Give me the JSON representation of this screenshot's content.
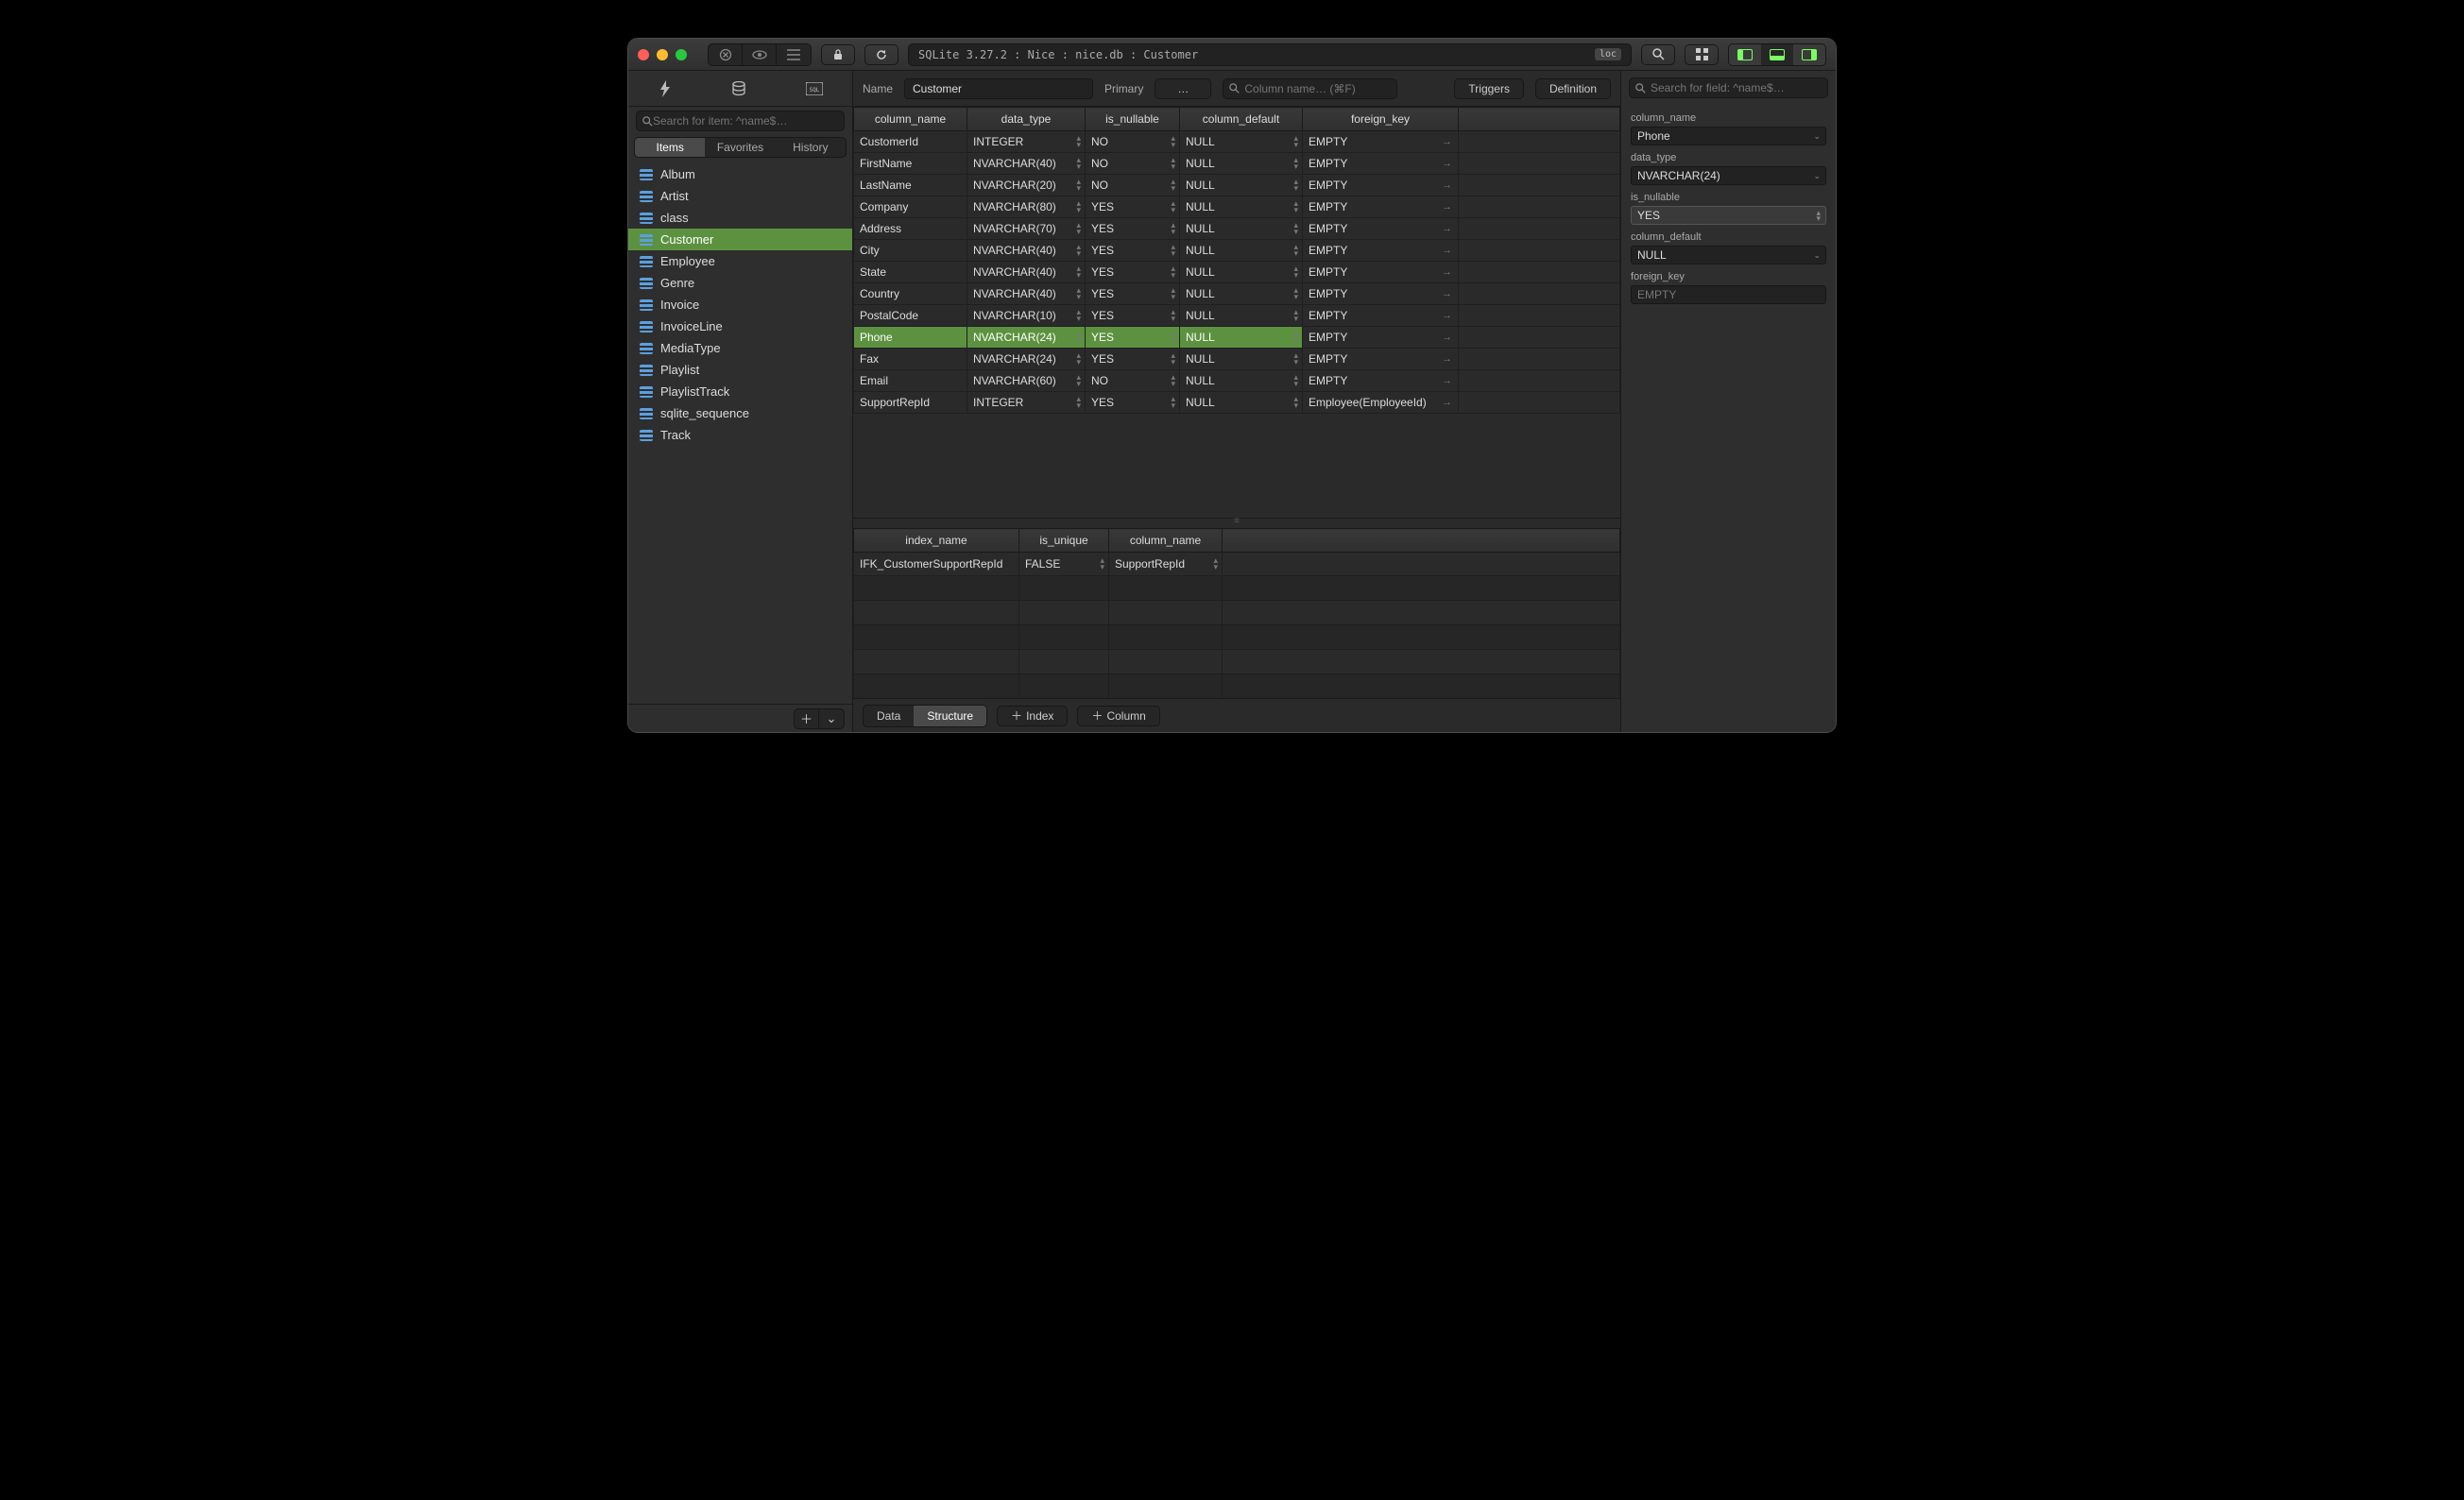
{
  "titlebar": {
    "path": "SQLite 3.27.2 : Nice : nice.db : Customer",
    "loc_chip": "loc"
  },
  "sidebar": {
    "search_placeholder": "Search for item: ^name$…",
    "tabs": {
      "items": "Items",
      "favorites": "Favorites",
      "history": "History"
    },
    "items": [
      {
        "label": "Album"
      },
      {
        "label": "Artist"
      },
      {
        "label": "class"
      },
      {
        "label": "Customer",
        "selected": true
      },
      {
        "label": "Employee"
      },
      {
        "label": "Genre"
      },
      {
        "label": "Invoice"
      },
      {
        "label": "InvoiceLine"
      },
      {
        "label": "MediaType"
      },
      {
        "label": "Playlist"
      },
      {
        "label": "PlaylistTrack"
      },
      {
        "label": "sqlite_sequence"
      },
      {
        "label": "Track"
      }
    ]
  },
  "header": {
    "name_label": "Name",
    "name_value": "Customer",
    "primary_label": "Primary",
    "primary_value": "…",
    "column_search_placeholder": "Column name… (⌘F)",
    "triggers_btn": "Triggers",
    "definition_btn": "Definition"
  },
  "columns_grid": {
    "headers": [
      "column_name",
      "data_type",
      "is_nullable",
      "column_default",
      "foreign_key"
    ],
    "rows": [
      {
        "name": "CustomerId",
        "type": "INTEGER",
        "nullable": "NO",
        "default": "NULL",
        "fk": "EMPTY"
      },
      {
        "name": "FirstName",
        "type": "NVARCHAR(40)",
        "nullable": "NO",
        "default": "NULL",
        "fk": "EMPTY"
      },
      {
        "name": "LastName",
        "type": "NVARCHAR(20)",
        "nullable": "NO",
        "default": "NULL",
        "fk": "EMPTY"
      },
      {
        "name": "Company",
        "type": "NVARCHAR(80)",
        "nullable": "YES",
        "default": "NULL",
        "fk": "EMPTY"
      },
      {
        "name": "Address",
        "type": "NVARCHAR(70)",
        "nullable": "YES",
        "default": "NULL",
        "fk": "EMPTY"
      },
      {
        "name": "City",
        "type": "NVARCHAR(40)",
        "nullable": "YES",
        "default": "NULL",
        "fk": "EMPTY"
      },
      {
        "name": "State",
        "type": "NVARCHAR(40)",
        "nullable": "YES",
        "default": "NULL",
        "fk": "EMPTY"
      },
      {
        "name": "Country",
        "type": "NVARCHAR(40)",
        "nullable": "YES",
        "default": "NULL",
        "fk": "EMPTY"
      },
      {
        "name": "PostalCode",
        "type": "NVARCHAR(10)",
        "nullable": "YES",
        "default": "NULL",
        "fk": "EMPTY"
      },
      {
        "name": "Phone",
        "type": "NVARCHAR(24)",
        "nullable": "YES",
        "default": "NULL",
        "fk": "EMPTY",
        "selected": true
      },
      {
        "name": "Fax",
        "type": "NVARCHAR(24)",
        "nullable": "YES",
        "default": "NULL",
        "fk": "EMPTY"
      },
      {
        "name": "Email",
        "type": "NVARCHAR(60)",
        "nullable": "NO",
        "default": "NULL",
        "fk": "EMPTY"
      },
      {
        "name": "SupportRepId",
        "type": "INTEGER",
        "nullable": "YES",
        "default": "NULL",
        "fk": "Employee(EmployeeId)"
      }
    ]
  },
  "index_grid": {
    "headers": [
      "index_name",
      "is_unique",
      "column_name"
    ],
    "rows": [
      {
        "name": "IFK_CustomerSupportRepId",
        "unique": "FALSE",
        "column": "SupportRepId"
      }
    ]
  },
  "bottombar": {
    "data": "Data",
    "structure": "Structure",
    "add_index": "Index",
    "add_column": "Column"
  },
  "inspector": {
    "search_placeholder": "Search for field: ^name$…",
    "fields": {
      "column_name_label": "column_name",
      "column_name_value": "Phone",
      "data_type_label": "data_type",
      "data_type_value": "NVARCHAR(24)",
      "is_nullable_label": "is_nullable",
      "is_nullable_value": "YES",
      "column_default_label": "column_default",
      "column_default_value": "NULL",
      "foreign_key_label": "foreign_key",
      "foreign_key_value": "EMPTY"
    }
  }
}
